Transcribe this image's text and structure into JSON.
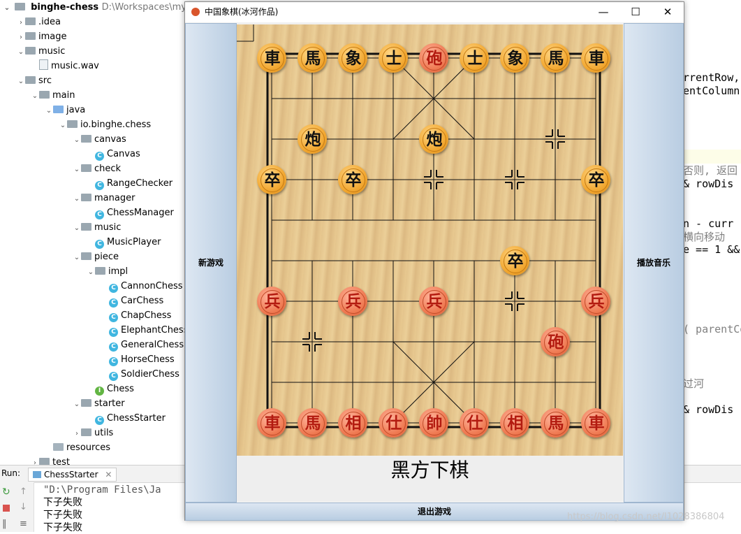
{
  "project_tree": {
    "root_name": "binghe-chess",
    "root_path": "D:\\Workspaces\\mykit\\ch",
    "items": [
      {
        "label": ".idea",
        "icon": "folder",
        "arrow": "›",
        "indent": 1
      },
      {
        "label": "image",
        "icon": "folder",
        "arrow": "›",
        "indent": 1
      },
      {
        "label": "music",
        "icon": "folder",
        "arrow": "⌄",
        "indent": 1
      },
      {
        "label": "music.wav",
        "icon": "file",
        "arrow": "",
        "indent": 2
      },
      {
        "label": "src",
        "icon": "folder",
        "arrow": "⌄",
        "indent": 1
      },
      {
        "label": "main",
        "icon": "folder",
        "arrow": "⌄",
        "indent": 2
      },
      {
        "label": "java",
        "icon": "java",
        "arrow": "⌄",
        "indent": 3
      },
      {
        "label": "io.binghe.chess",
        "icon": "folder",
        "arrow": "⌄",
        "indent": 4
      },
      {
        "label": "canvas",
        "icon": "folder",
        "arrow": "⌄",
        "indent": 5
      },
      {
        "label": "Canvas",
        "icon": "class",
        "arrow": "",
        "indent": 6
      },
      {
        "label": "check",
        "icon": "folder",
        "arrow": "⌄",
        "indent": 5
      },
      {
        "label": "RangeChecker",
        "icon": "class",
        "arrow": "",
        "indent": 6
      },
      {
        "label": "manager",
        "icon": "folder",
        "arrow": "⌄",
        "indent": 5
      },
      {
        "label": "ChessManager",
        "icon": "class",
        "arrow": "",
        "indent": 6
      },
      {
        "label": "music",
        "icon": "folder",
        "arrow": "⌄",
        "indent": 5
      },
      {
        "label": "MusicPlayer",
        "icon": "class",
        "arrow": "",
        "indent": 6
      },
      {
        "label": "piece",
        "icon": "folder",
        "arrow": "⌄",
        "indent": 5
      },
      {
        "label": "impl",
        "icon": "folder",
        "arrow": "⌄",
        "indent": 6
      },
      {
        "label": "CannonChess",
        "icon": "class",
        "arrow": "",
        "indent": 7
      },
      {
        "label": "CarChess",
        "icon": "class",
        "arrow": "",
        "indent": 7
      },
      {
        "label": "ChapChess",
        "icon": "class",
        "arrow": "",
        "indent": 7
      },
      {
        "label": "ElephantChess",
        "icon": "class",
        "arrow": "",
        "indent": 7
      },
      {
        "label": "GeneralChess",
        "icon": "class",
        "arrow": "",
        "indent": 7
      },
      {
        "label": "HorseChess",
        "icon": "class",
        "arrow": "",
        "indent": 7
      },
      {
        "label": "SoldierChess",
        "icon": "class",
        "arrow": "",
        "indent": 7
      },
      {
        "label": "Chess",
        "icon": "interface",
        "arrow": "",
        "indent": 6
      },
      {
        "label": "starter",
        "icon": "folder",
        "arrow": "⌄",
        "indent": 5
      },
      {
        "label": "ChessStarter",
        "icon": "class",
        "arrow": "",
        "indent": 6
      },
      {
        "label": "utils",
        "icon": "folder",
        "arrow": "›",
        "indent": 5
      },
      {
        "label": "resources",
        "icon": "resources",
        "arrow": "",
        "indent": 3
      },
      {
        "label": "test",
        "icon": "folder",
        "arrow": "›",
        "indent": 2
      }
    ]
  },
  "code_fragments": [
    {
      "text": "rrentRow,",
      "color": "#000000"
    },
    {
      "text": "entColumn",
      "color": "#000000"
    },
    {
      "text": "否则, 返回",
      "color": "#808080"
    },
    {
      "text": "& rowDis",
      "color": "#000000"
    },
    {
      "text": "n - curr",
      "color": "#000000"
    },
    {
      "text": "横向移动",
      "color": "#808080"
    },
    {
      "text": "e == 1 &&",
      "color": "#000000"
    },
    {
      "text": "( parentCo",
      "color": "#808080"
    },
    {
      "text": "过河",
      "color": "#808080"
    },
    {
      "text": "& rowDis",
      "color": "#000000"
    }
  ],
  "run_panel": {
    "run_label": "Run:",
    "tab_label": "ChessStarter",
    "console_lines": [
      "\"D:\\Program Files\\Ja",
      "下子失败",
      "下子失败",
      "下子失败"
    ]
  },
  "game_window": {
    "title": "中国象棋(冰河作品)",
    "min_glyph": "—",
    "max_glyph": "☐",
    "close_glyph": "✕",
    "new_game_label": "新游戏",
    "play_music_label": "播放音乐",
    "status_text": "黑方下棋",
    "exit_label": "退出游戏"
  },
  "pieces": [
    {
      "char": "車",
      "side": "black",
      "col": 0,
      "row": 0
    },
    {
      "char": "馬",
      "side": "black",
      "col": 1,
      "row": 0
    },
    {
      "char": "象",
      "side": "black",
      "col": 2,
      "row": 0
    },
    {
      "char": "士",
      "side": "black",
      "col": 3,
      "row": 0
    },
    {
      "char": "砲",
      "side": "red",
      "col": 4,
      "row": 0
    },
    {
      "char": "士",
      "side": "black",
      "col": 5,
      "row": 0
    },
    {
      "char": "象",
      "side": "black",
      "col": 6,
      "row": 0
    },
    {
      "char": "馬",
      "side": "black",
      "col": 7,
      "row": 0
    },
    {
      "char": "車",
      "side": "black",
      "col": 8,
      "row": 0
    },
    {
      "char": "炮",
      "side": "black",
      "col": 1,
      "row": 2
    },
    {
      "char": "炮",
      "side": "black",
      "col": 4,
      "row": 2
    },
    {
      "char": "卒",
      "side": "black",
      "col": 0,
      "row": 3
    },
    {
      "char": "卒",
      "side": "black",
      "col": 2,
      "row": 3
    },
    {
      "char": "卒",
      "side": "black",
      "col": 8,
      "row": 3
    },
    {
      "char": "卒",
      "side": "black",
      "col": 6,
      "row": 5
    },
    {
      "char": "兵",
      "side": "red",
      "col": 0,
      "row": 6
    },
    {
      "char": "兵",
      "side": "red",
      "col": 2,
      "row": 6
    },
    {
      "char": "兵",
      "side": "red",
      "col": 4,
      "row": 6
    },
    {
      "char": "兵",
      "side": "red",
      "col": 8,
      "row": 6
    },
    {
      "char": "砲",
      "side": "red",
      "col": 7,
      "row": 7
    },
    {
      "char": "車",
      "side": "red",
      "col": 0,
      "row": 9
    },
    {
      "char": "馬",
      "side": "red",
      "col": 1,
      "row": 9
    },
    {
      "char": "相",
      "side": "red",
      "col": 2,
      "row": 9
    },
    {
      "char": "仕",
      "side": "red",
      "col": 3,
      "row": 9
    },
    {
      "char": "帥",
      "side": "red",
      "col": 4,
      "row": 9
    },
    {
      "char": "仕",
      "side": "red",
      "col": 5,
      "row": 9
    },
    {
      "char": "相",
      "side": "red",
      "col": 6,
      "row": 9
    },
    {
      "char": "馬",
      "side": "red",
      "col": 7,
      "row": 9
    },
    {
      "char": "車",
      "side": "red",
      "col": 8,
      "row": 9
    }
  ],
  "markers": [
    {
      "col": 7,
      "row": 2
    },
    {
      "col": 4,
      "row": 3
    },
    {
      "col": 6,
      "row": 3
    },
    {
      "col": 6,
      "row": 6
    },
    {
      "col": 1,
      "row": 7
    }
  ],
  "colors": {
    "board": "#e6c690",
    "black_piece": "#f2a730",
    "red_piece": "#ef7a52",
    "red_text": "#b31b10"
  },
  "watermark": "https://blog.csdn.net/l1028386804"
}
